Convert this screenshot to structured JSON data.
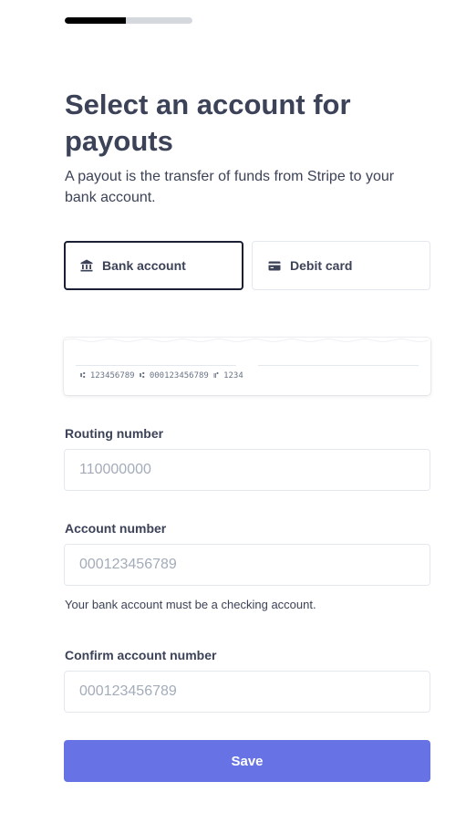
{
  "progress": {
    "fraction": 0.48
  },
  "heading": {
    "title": "Select an account for payouts",
    "subtitle": "A payout is the transfer of funds from Stripe to your bank account."
  },
  "tabs": [
    {
      "label": "Bank account",
      "icon": "bank-icon",
      "active": true
    },
    {
      "label": "Debit card",
      "icon": "credit-card-icon",
      "active": false
    }
  ],
  "check": {
    "micr": "⑆ 123456789 ⑆ 000123456789 ⑈ 1234"
  },
  "routing": {
    "label": "Routing number",
    "placeholder": "110000000"
  },
  "account": {
    "label": "Account number",
    "placeholder": "000123456789",
    "hint": "Your bank account must be a checking account."
  },
  "confirm": {
    "label": "Confirm account number",
    "placeholder": "000123456789"
  },
  "save_label": "Save",
  "colors": {
    "accent": "#6772e5",
    "text": "#3c4257",
    "border": "#e3e8ee"
  }
}
